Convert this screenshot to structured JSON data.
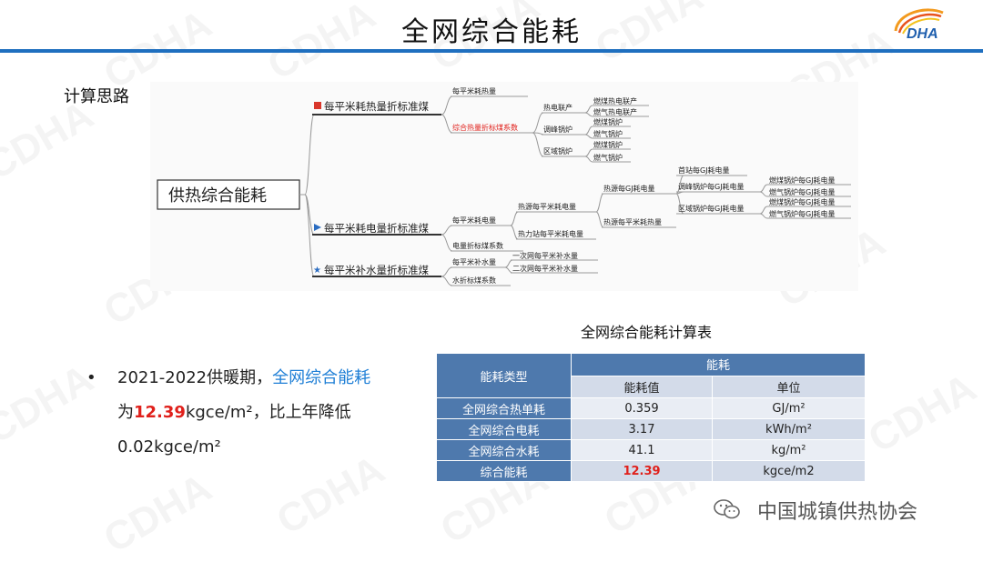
{
  "header": {
    "title": "全网综合能耗",
    "logo_text": "DHA",
    "accent": "#1f6fbf"
  },
  "watermark": "CDHA",
  "section_label": "计算思路",
  "mindmap": {
    "root": "供热综合能耗",
    "b1": {
      "label": "每平米耗热量折标准煤",
      "c1": "每平米耗热量",
      "c2": "综合热量折标煤系数",
      "g1": "热电联产",
      "g1a": "燃煤热电联产",
      "g1b": "燃气热电联产",
      "g2": "调峰锅炉",
      "g2a": "燃煤锅炉",
      "g2b": "燃气锅炉",
      "g3": "区域锅炉",
      "g3a": "燃煤锅炉",
      "g3b": "燃气锅炉"
    },
    "b2": {
      "label": "每平米耗电量折标准煤",
      "c1": "每平米耗电量",
      "c2": "电量折标煤系数",
      "d1": "热源每平米耗电量",
      "d2": "热力站每平米耗电量",
      "e1": "热源每GJ耗电量",
      "e2": "热源每平米耗热量",
      "f1": "首站每GJ耗电量",
      "f2": "调峰锅炉每GJ耗电量",
      "f3": "区域锅炉每GJ耗电量",
      "h1": "燃煤锅炉每GJ耗电量",
      "h2": "燃气锅炉每GJ耗电量",
      "h3": "燃煤锅炉每GJ耗电量",
      "h4": "燃气锅炉每GJ耗电量"
    },
    "b3": {
      "label": "每平米补水量折标准煤",
      "c1": "每平米补水量",
      "c2": "水折标煤系数",
      "d1": "一次网每平米补水量",
      "d2": "二次网每平米补水量"
    }
  },
  "bullet": {
    "marker": "•",
    "p1": "2021-2022供暖期，",
    "p2": "全网综合能耗",
    "p3": "为",
    "p4": "12.39",
    "p5": "kgce/m²，比上年降低0.02kgce/m²"
  },
  "table": {
    "title": "全网综合能耗计算表",
    "h_type": "能耗类型",
    "h_group": "能耗",
    "h_value": "能耗值",
    "h_unit": "单位",
    "rows": [
      {
        "name": "全网综合热单耗",
        "value": "0.359",
        "unit": "GJ/m²"
      },
      {
        "name": "全网综合电耗",
        "value": "3.17",
        "unit": "kWh/m²"
      },
      {
        "name": "全网综合水耗",
        "value": "41.1",
        "unit": "kg/m²"
      },
      {
        "name": "综合能耗",
        "value": "12.39",
        "unit": "kgce/m2"
      }
    ]
  },
  "footer": {
    "text": "中国城镇供热协会",
    "icon": "wechat-icon"
  }
}
